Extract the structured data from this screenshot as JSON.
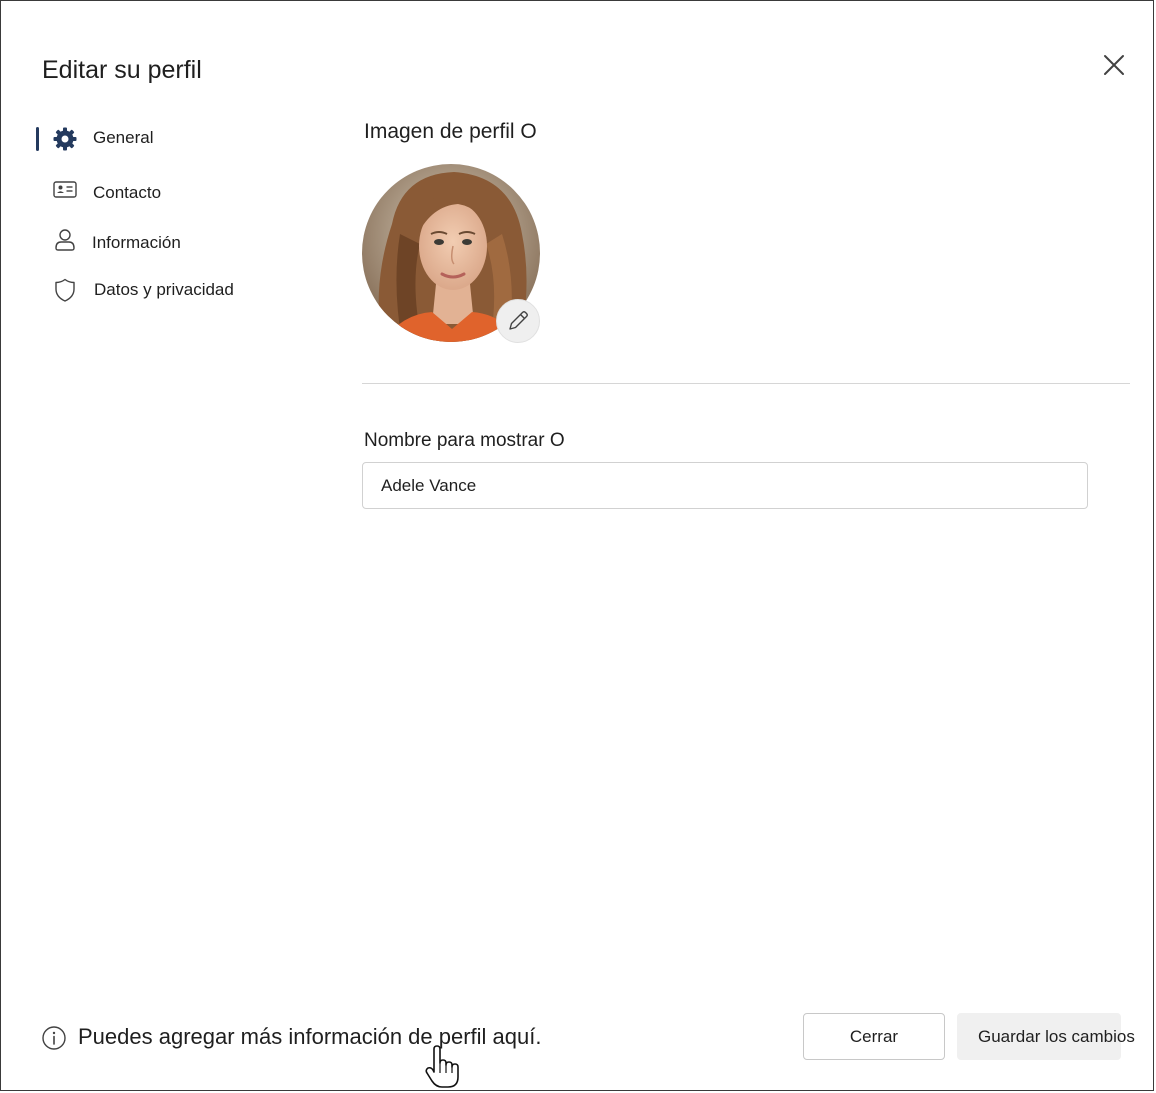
{
  "dialog": {
    "title": "Editar su perfil"
  },
  "sidebar": {
    "items": [
      {
        "label": "General",
        "icon": "gear-icon",
        "active": true
      },
      {
        "label": "Contacto",
        "icon": "contact-card-icon",
        "active": false
      },
      {
        "label": "Información",
        "icon": "person-icon",
        "active": false
      },
      {
        "label": "Datos y privacidad",
        "icon": "shield-icon",
        "active": false
      }
    ]
  },
  "main": {
    "profile_picture_title": "Imagen de perfil O",
    "display_name_title": "Nombre para mostrar O",
    "display_name_value": "Adele Vance"
  },
  "footer": {
    "info_text": "Puedes agregar más información de perfil aquí.",
    "cancel_label": "Cerrar",
    "save_label": "Guardar los cambios"
  },
  "colors": {
    "accent": "#243a5e",
    "border": "#d1d1d1",
    "save_button_bg": "#f0f0f0"
  }
}
